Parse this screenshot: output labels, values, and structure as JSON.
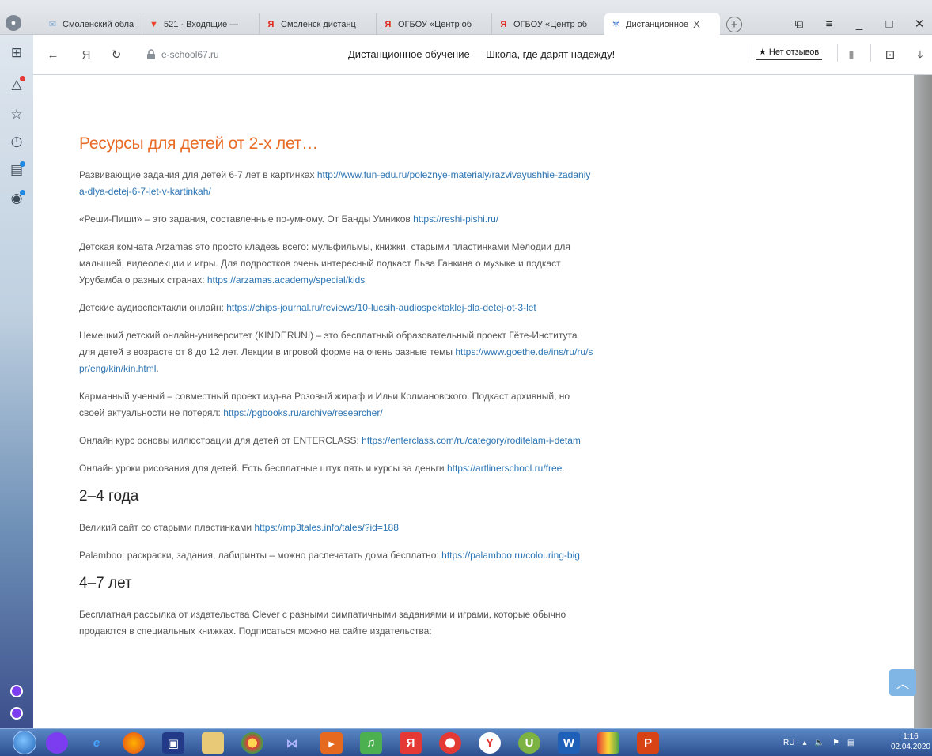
{
  "browser": {
    "tabs": [
      {
        "label": "Смоленский обла",
        "favicon": "mail-icon",
        "color": "#8ab0d8"
      },
      {
        "label": "521 · Входящие —",
        "favicon": "inbox-icon",
        "color": "#e8442f"
      },
      {
        "label": "Смоленск дистанц",
        "favicon": "Я",
        "color": "#e02b1c"
      },
      {
        "label": "ОГБОУ «Центр об",
        "favicon": "Я",
        "color": "#e02b1c"
      },
      {
        "label": "ОГБОУ «Центр об",
        "favicon": "Я",
        "color": "#e02b1c"
      },
      {
        "label": "Дистанционное",
        "favicon": "site-icon",
        "color": "#3b6fc2",
        "active": true
      }
    ],
    "tab_close_label": "X",
    "address": {
      "domain": "e-school67.ru",
      "yandex_letter": "Я",
      "title": "Дистанционное обучение — Школа, где дарят надежду!",
      "reviews_label": "★ Нет отзывов"
    }
  },
  "page": {
    "sections": [
      {
        "heading": "Ресурсы для детей от 2-х лет…",
        "style": "orange",
        "paragraphs": [
          {
            "text": "Развивающие задания для детей 6-7 лет в картинках    ",
            "link": "http://www.fun-edu.ru/poleznye-materialy/razvivayushhie-zadaniya-dlya-detej-6-7-let-v-kartinkah/",
            "after": ""
          },
          {
            "text": "«Реши-Пиши» – это задания, составленные по-умному. От Банды Умников ",
            "link": "https://reshi-pishi.ru/",
            "after": ""
          },
          {
            "text": "Детская комната Arzamas это просто кладезь всего:  мульфильмы, книжки, старыми пластинками Мелодии для малышей, видеолекции и игры. Для подростков очень интересный подкаст Льва Ганкина о музыке и  подкаст Урубамба о разных странах: ",
            "link": "https://arzamas.academy/special/kids",
            "after": ""
          },
          {
            "text": "Детские аудиоспектакли онлайн: ",
            "link": "https://chips-journal.ru/reviews/10-lucsih-audiospektaklej-dla-detej-ot-3-let",
            "after": ""
          },
          {
            "text": "Немецкий детский онлайн-университет (KINDERUNI) – это бесплатный образовательный проект Гёте-Института для детей в возрасте от 8 до 12 лет. Лекции в игровой форме на очень разные темы ",
            "link": "https://www.goethe.de/ins/ru/ru/spr/eng/kin/kin.html",
            "after": "."
          },
          {
            "text": "Карманный ученый – совместный проект  изд-ва Розовый жираф и Ильи Колмановского. Подкаст архивный, но своей актуальности не потерял:  ",
            "link": "https://pgbooks.ru/archive/researcher/",
            "after": ""
          },
          {
            "text": "Онлайн курс основы иллюстрации для детей от ENTERCLASS: ",
            "link": "https://enterclass.com/ru/category/roditelam-i-detam",
            "after": ""
          },
          {
            "text": " Онлайн уроки рисования для детей. Есть бесплатные штук пять и курсы за деньги ",
            "link": "https://artlinerschool.ru/free",
            "after": "."
          }
        ]
      },
      {
        "heading": "2–4 года",
        "style": "dark",
        "paragraphs": [
          {
            "text": "Великий сайт со старыми пластинками ",
            "link": "https://mp3tales.info/tales/?id=188",
            "after": ""
          },
          {
            "text": "Palamboo: раскраски, задания, лабиринты – можно распечатать дома бесплатно: ",
            "link": "https://palamboo.ru/colouring-big",
            "after": ""
          }
        ]
      },
      {
        "heading": "4–7 лет",
        "style": "dark",
        "paragraphs": [
          {
            "text": "Бесплатная рассылка от издательства Clever с разными симпатичными заданиями и играми, которые обычно продаются в специальных книжках. Подписаться можно на сайте издательства:",
            "link": "",
            "after": ""
          }
        ]
      }
    ]
  },
  "taskbar": {
    "language": "RU",
    "time": "1:16",
    "date": "02.04.2020"
  },
  "colors": {
    "heading_orange": "#e86a25",
    "link_blue": "#2b74b3"
  }
}
